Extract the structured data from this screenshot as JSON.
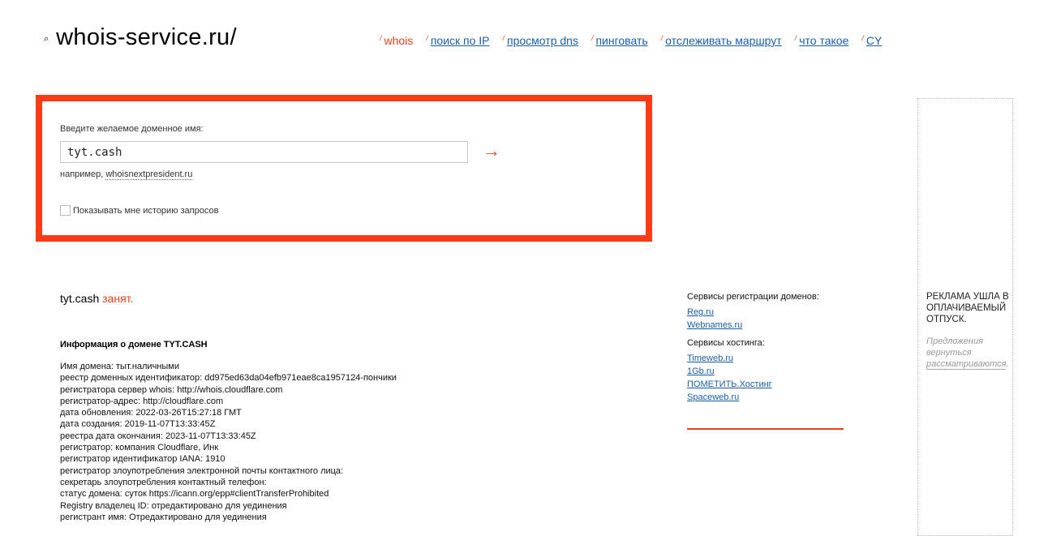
{
  "header": {
    "logo_icon": "⌕",
    "logo_text": "whois-service.ru/",
    "nav": [
      {
        "label": "whois",
        "active": true
      },
      {
        "label": "поиск по IP",
        "active": false
      },
      {
        "label": "просмотр dns",
        "active": false
      },
      {
        "label": "пинговать",
        "active": false
      },
      {
        "label": "отслеживать маршрут",
        "active": false
      },
      {
        "label": "что такое",
        "active": false
      },
      {
        "label": "CY",
        "active": false
      }
    ],
    "nav_slash": "/"
  },
  "search": {
    "label": "Введите желаемое доменное имя:",
    "value": "tyt.cash",
    "submit_arrow": "→",
    "example_prefix": "например, ",
    "example_link": "whoisnextpresident.ru",
    "history_label": "Показывать мне историю запросов",
    "history_checked": false
  },
  "result": {
    "domain": "tyt.cash",
    "status": "занят."
  },
  "info": {
    "title": "Информация о домене TYT.CASH",
    "lines": [
      "Имя домена: тыт.наличными",
      "реестр доменных идентификатор: dd975ed63da04efb971eae8ca1957124-пончики",
      "регистратора сервер whois: http://whois.cloudflare.com",
      "регистратор-адрес: http://cloudflare.com",
      "дата обновления: 2022-03-26T15:27:18 ГМТ",
      "дата создания: 2019-11-07T13:33:45Z",
      "реестра дата окончания: 2023-11-07T13:33:45Z",
      "регистратор: компания Cloudflare, Инк",
      "регистратор идентификатор IANA: 1910",
      "регистратор злоупотребления электронной почты контактного лица:",
      "секретарь злоупотребления контактный телефон:",
      "статус домена: суток https://icann.org/epp#clientTransferProhibited",
      "Registry владелец ID: отредактировано для уединения",
      "регистрант имя: Отредактировано для уединения"
    ]
  },
  "services": {
    "registration_heading": "Сервисы регистрации доменов:",
    "registration_links": [
      "Reg.ru",
      "Webnames.ru"
    ],
    "hosting_heading": "Сервисы хостинга:",
    "hosting_links": [
      "Timeweb.ru",
      "1Gb.ru",
      "ПОМЕТИТЬ.Хостинг",
      "Spaceweb.ru"
    ]
  },
  "ad": {
    "title": "РЕКЛАМА УШЛА В ОПЛАЧИВАЕМЫЙ ОТПУСК.",
    "note_prefix": "Предложения вернуться ",
    "note_link": "рассматриваются",
    "note_suffix": "."
  },
  "colors": {
    "accent": "#e8421a",
    "search_border": "#ff3a14",
    "link": "#1a5fa8"
  }
}
